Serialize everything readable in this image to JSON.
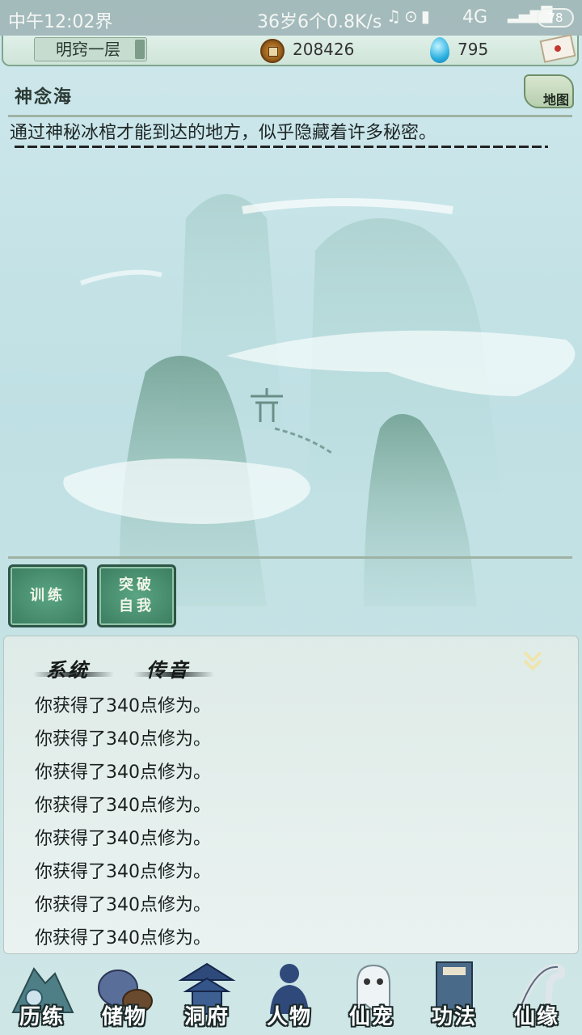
{
  "status_bar": {
    "time": "中午12:02",
    "overlay_text": "界",
    "network_info": "36岁6个0.8K/s",
    "network_type": "4G",
    "battery": "78"
  },
  "top_bar": {
    "realm": "明窍一层",
    "copper_coins": "208426",
    "spirit_stones": "795"
  },
  "location": {
    "title": "神念海",
    "description": "通过神秘冰棺才能到达的地方，似乎隐藏着许多秘密。",
    "map_label": "地图"
  },
  "actions": {
    "train": "训练",
    "breakthrough_line1": "突破",
    "breakthrough_line2": "自我"
  },
  "messages": {
    "tabs": [
      "系统",
      "传音"
    ],
    "items": [
      "你获得了340点修为。",
      "你获得了340点修为。",
      "你获得了340点修为。",
      "你获得了340点修为。",
      "你获得了340点修为。",
      "你获得了340点修为。",
      "你获得了340点修为。",
      "你获得了340点修为。"
    ]
  },
  "bottom_nav": [
    "历练",
    "储物",
    "洞府",
    "人物",
    "仙宠",
    "功法",
    "仙缘"
  ]
}
